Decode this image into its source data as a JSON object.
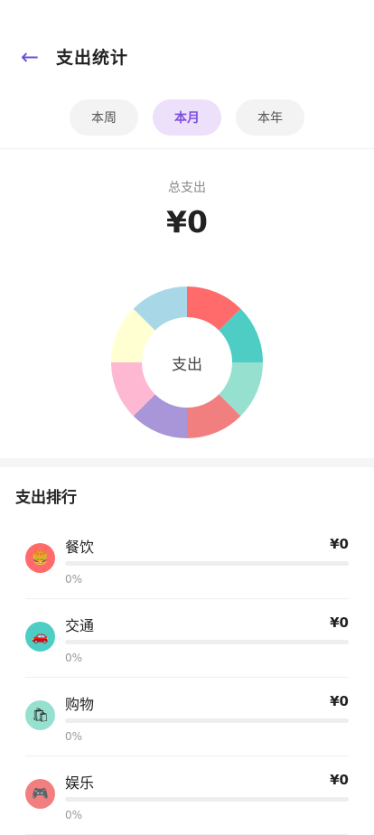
{
  "header": {
    "back_icon": "arrow-left-icon",
    "back_glyph": "←",
    "title": "支出统计"
  },
  "tabs": [
    {
      "label": "本周",
      "active": false
    },
    {
      "label": "本月",
      "active": true
    },
    {
      "label": "本年",
      "active": false
    }
  ],
  "summary": {
    "total_label": "总支出",
    "total_value": "¥0"
  },
  "donut": {
    "center_label": "支出",
    "segment_colors": [
      "#ff6b6b",
      "#4ecdc4",
      "#96e0d0",
      "#f27f7f",
      "#a896d8",
      "#ffb8d2",
      "#ffffd2",
      "#a8d8e8"
    ]
  },
  "ranking": {
    "title": "支出排行",
    "items": [
      {
        "name": "餐饮",
        "amount": "¥0",
        "percent": "0%",
        "fraction": 0,
        "icon": "burger-icon",
        "glyph": "🍔",
        "color": "#ff6b6b"
      },
      {
        "name": "交通",
        "amount": "¥0",
        "percent": "0%",
        "fraction": 0,
        "icon": "car-icon",
        "glyph": "🚗",
        "color": "#4ecdc4"
      },
      {
        "name": "购物",
        "amount": "¥0",
        "percent": "0%",
        "fraction": 0,
        "icon": "shopping-bag-icon",
        "glyph": "🛍",
        "color": "#96e0d0"
      },
      {
        "name": "娱乐",
        "amount": "¥0",
        "percent": "0%",
        "fraction": 0,
        "icon": "gamepad-icon",
        "glyph": "🎮",
        "color": "#f27f7f"
      }
    ]
  }
}
